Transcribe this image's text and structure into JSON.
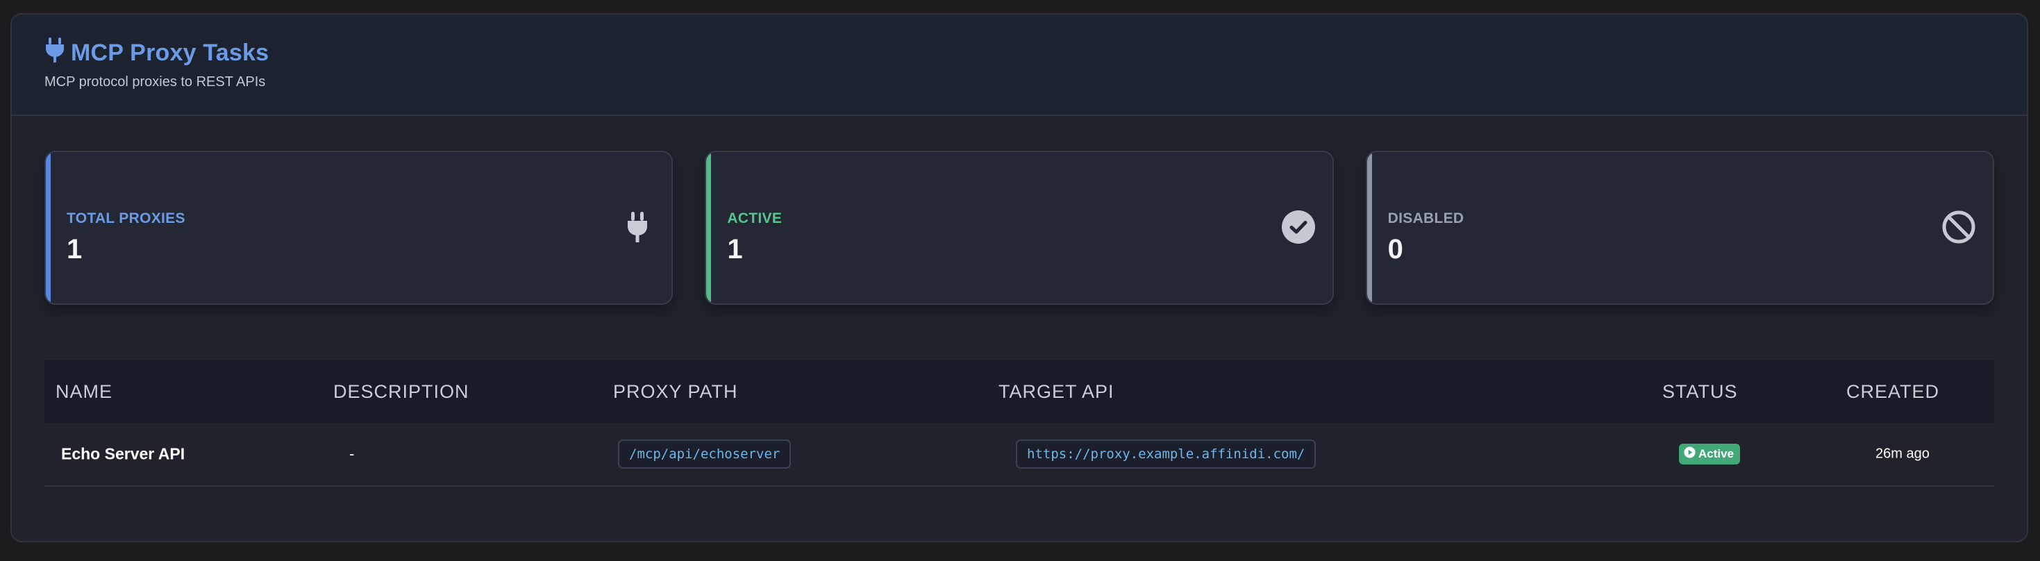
{
  "header": {
    "title": "MCP Proxy Tasks",
    "subtitle": "MCP protocol proxies to REST APIs",
    "icon": "plug-icon"
  },
  "stats": [
    {
      "label": "TOTAL PROXIES",
      "value": "1",
      "icon": "plug-icon",
      "accent_color": "#5b86e0"
    },
    {
      "label": "ACTIVE",
      "value": "1",
      "icon": "check-circle-icon",
      "accent_color": "#4fbf88"
    },
    {
      "label": "DISABLED",
      "value": "0",
      "icon": "ban-icon",
      "accent_color": "#8f95a3"
    }
  ],
  "table": {
    "columns": [
      "NAME",
      "DESCRIPTION",
      "PROXY PATH",
      "TARGET API",
      "STATUS",
      "CREATED"
    ],
    "rows": [
      {
        "name": "Echo Server API",
        "description": "-",
        "proxy_path": "/mcp/api/echoserver",
        "target_api": "https://proxy.example.affinidi.com/",
        "status": "Active",
        "created": "26m ago"
      }
    ]
  },
  "colors": {
    "brand_blue": "#6c9be5",
    "active_green": "#43a878",
    "code_text": "#6fb6e8"
  }
}
